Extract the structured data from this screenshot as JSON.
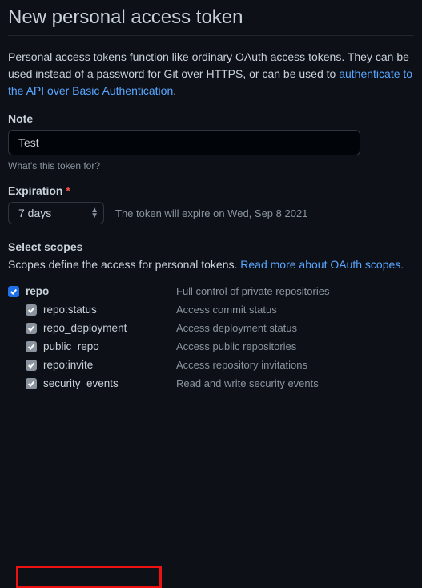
{
  "title": "New personal access token",
  "description": {
    "prefix": "Personal access tokens function like ordinary OAuth access tokens. They can be used instead of a password for Git over HTTPS, or can be used to ",
    "link": "authenticate to the API over Basic Authentication",
    "suffix": "."
  },
  "note": {
    "label": "Note",
    "value": "Test",
    "hint": "What's this token for?"
  },
  "expiration": {
    "label": "Expiration",
    "value": "7 days",
    "message": "The token will expire on Wed, Sep 8 2021"
  },
  "scopes": {
    "title": "Select scopes",
    "desc_prefix": "Scopes define the access for personal tokens. ",
    "desc_link": "Read more about OAuth scopes.",
    "items": [
      {
        "name": "repo",
        "desc": "Full control of private repositories",
        "checked": true,
        "parent": true
      },
      {
        "name": "repo:status",
        "desc": "Access commit status",
        "checked": true
      },
      {
        "name": "repo_deployment",
        "desc": "Access deployment status",
        "checked": true
      },
      {
        "name": "public_repo",
        "desc": "Access public repositories",
        "checked": true
      },
      {
        "name": "repo:invite",
        "desc": "Access repository invitations",
        "checked": true
      },
      {
        "name": "security_events",
        "desc": "Read and write security events",
        "checked": true
      }
    ]
  }
}
